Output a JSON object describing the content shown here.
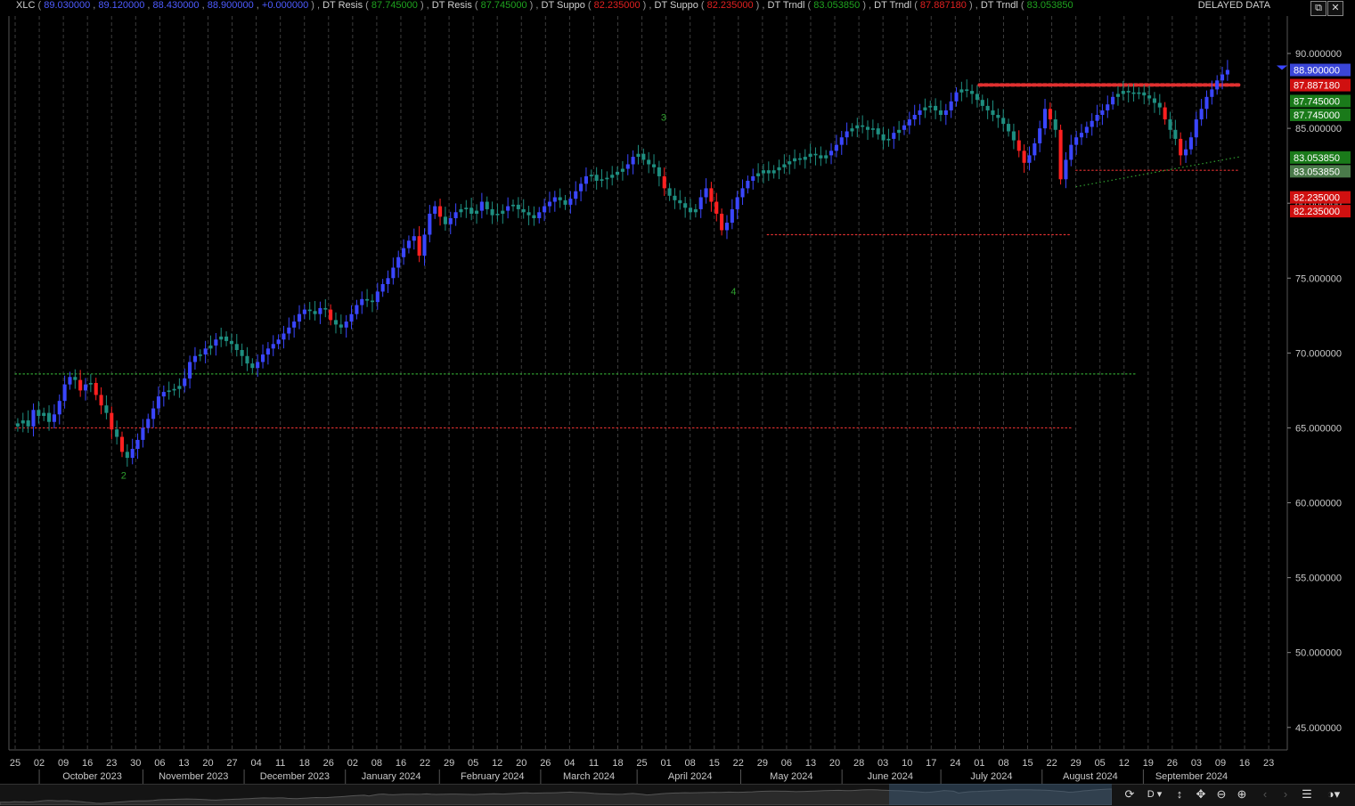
{
  "header": {
    "symbol": "XLC",
    "ohlc": [
      {
        "value": "89.030000",
        "color": "blue"
      },
      {
        "value": "89.120000",
        "color": "blue"
      },
      {
        "value": "88.430000",
        "color": "blue"
      },
      {
        "value": "88.900000",
        "color": "blue"
      },
      {
        "value": "+0.000000",
        "color": "blue"
      }
    ],
    "indicators": [
      {
        "label": "DT Resis",
        "value": "87.745000",
        "color": "green"
      },
      {
        "label": "DT Resis",
        "value": "87.745000",
        "color": "green"
      },
      {
        "label": "DT Suppo",
        "value": "82.235000",
        "color": "red"
      },
      {
        "label": "DT Suppo",
        "value": "82.235000",
        "color": "red"
      },
      {
        "label": "DT Trndl",
        "value": "83.053850",
        "color": "green"
      },
      {
        "label": "DT Trndl",
        "value": "87.887180",
        "color": "red"
      },
      {
        "label": "DT Trndl",
        "value": "83.053850",
        "color": "green"
      }
    ],
    "delayed_label": "DELAYED DATA",
    "restore_icon": "restore-window-icon",
    "close_icon": "close-icon"
  },
  "colors": {
    "up_blue": "#3a46ff",
    "up_teal": "#1e8e80",
    "down_red": "#ff2020",
    "grid": "#3c3c3c",
    "support_red": "#e03030",
    "resis_green": "#30a030",
    "badge_blue": "#3b46d8",
    "badge_red": "#d01010",
    "badge_green": "#1a7a1a",
    "badge_grey_green": "#4a7a4a"
  },
  "chart_data": {
    "type": "candlestick",
    "symbol": "XLC",
    "ylim": [
      43.5,
      92.5
    ],
    "y_ticks": [
      "90.000000",
      "85.000000",
      "80.000000",
      "75.000000",
      "70.000000",
      "65.000000",
      "60.000000",
      "55.000000",
      "50.000000",
      "45.000000"
    ],
    "y_tick_values": [
      90,
      85,
      80,
      75,
      70,
      65,
      60,
      55,
      50,
      45
    ],
    "date_ticks": [
      "25",
      "02",
      "09",
      "16",
      "23",
      "30",
      "06",
      "13",
      "20",
      "27",
      "04",
      "11",
      "18",
      "26",
      "02",
      "08",
      "16",
      "22",
      "29",
      "05",
      "12",
      "20",
      "26",
      "04",
      "11",
      "18",
      "25",
      "01",
      "08",
      "15",
      "22",
      "29",
      "06",
      "13",
      "20",
      "28",
      "03",
      "10",
      "17",
      "24",
      "01",
      "08",
      "15",
      "22",
      "29",
      "05",
      "12",
      "19",
      "26",
      "03",
      "09",
      "16",
      "23"
    ],
    "month_labels": [
      "October 2023",
      "November 2023",
      "December 2023",
      "January 2024",
      "February 2024",
      "March 2024",
      "April 2024",
      "May 2024",
      "June 2024",
      "July 2024",
      "August 2024",
      "September 2024"
    ],
    "month_label_weeks": [
      3.2,
      7.4,
      11.6,
      15.6,
      19.8,
      23.8,
      28.0,
      32.2,
      36.3,
      40.5,
      44.6,
      48.8
    ],
    "month_boundary_weeks": [
      1,
      5.3,
      9.5,
      13.7,
      17.6,
      21.8,
      25.8,
      30.1,
      34.3,
      38.4,
      42.6,
      46.8
    ],
    "price_badges": [
      {
        "value": "88.900000",
        "price": 88.9,
        "color": "badge_blue"
      },
      {
        "value": "87.887180",
        "price": 87.887,
        "color": "badge_red"
      },
      {
        "value": "87.745000",
        "price": 87.745,
        "color": "badge_green"
      },
      {
        "value": "87.745000",
        "price": 87.745,
        "color": "badge_green"
      },
      {
        "value": "83.053850",
        "price": 83.054,
        "color": "badge_green"
      },
      {
        "value": "83.053850",
        "price": 83.054,
        "color": "badge_grey_green"
      },
      {
        "value": "82.235000",
        "price": 82.235,
        "color": "badge_red"
      },
      {
        "value": "82.235000",
        "price": 82.235,
        "color": "badge_red"
      }
    ],
    "wave_labels": [
      {
        "text": "2",
        "week": 4.5,
        "price": 61.6
      },
      {
        "text": "3",
        "week": 26.9,
        "price": 85.5
      },
      {
        "text": "4",
        "week": 29.8,
        "price": 73.9
      }
    ],
    "levels": [
      {
        "name": "old-resistance",
        "price": 68.6,
        "from_week": 0,
        "to_week": 46.5,
        "color": "resis_green"
      },
      {
        "name": "old-support",
        "price": 65.0,
        "from_week": 0,
        "to_week": 43.8,
        "color": "support_red"
      },
      {
        "name": "april-support",
        "price": 77.9,
        "from_week": 31.2,
        "to_week": 43.8,
        "color": "support_red"
      },
      {
        "name": "resistance-top",
        "price": 87.9,
        "from_week": 40,
        "to_week": 50.8,
        "color": "support_red",
        "thick": true
      },
      {
        "name": "support-aug",
        "price": 82.2,
        "from_week": 44,
        "to_week": 50.8,
        "color": "support_red"
      }
    ],
    "trendline": {
      "from_week": 44,
      "from_price": 81.1,
      "to_week": 50.8,
      "to_price": 83.1,
      "color": "resis_green"
    },
    "closes": [
      65.3,
      65.5,
      65.1,
      66.2,
      65.8,
      66.0,
      65.4,
      65.9,
      66.8,
      67.9,
      68.4,
      68.2,
      67.5,
      67.9,
      68.0,
      67.2,
      66.5,
      66.0,
      64.9,
      64.4,
      63.4,
      63.0,
      63.6,
      64.2,
      65.0,
      65.6,
      66.3,
      67.1,
      67.4,
      67.5,
      67.6,
      67.8,
      68.3,
      69.4,
      69.8,
      69.9,
      70.3,
      70.5,
      70.9,
      71.1,
      70.8,
      70.6,
      70.2,
      69.8,
      69.3,
      69.0,
      69.4,
      69.9,
      70.3,
      70.6,
      70.9,
      71.3,
      71.7,
      72.1,
      72.6,
      72.9,
      72.8,
      72.6,
      73.0,
      72.9,
      72.2,
      71.9,
      71.7,
      72.1,
      72.6,
      73.2,
      73.6,
      73.5,
      73.4,
      74.1,
      74.6,
      75.0,
      75.7,
      76.4,
      77.0,
      77.5,
      77.8,
      76.5,
      77.9,
      79.3,
      79.8,
      79.1,
      78.6,
      79.0,
      79.4,
      79.6,
      79.7,
      79.3,
      79.5,
      80.1,
      79.6,
      79.2,
      79.3,
      79.5,
      79.8,
      79.9,
      79.6,
      79.4,
      79.2,
      79.0,
      79.4,
      79.8,
      80.1,
      80.4,
      80.2,
      79.9,
      80.3,
      80.8,
      81.3,
      81.8,
      81.9,
      81.5,
      81.6,
      81.7,
      81.9,
      82.1,
      82.3,
      82.6,
      83.1,
      83.3,
      82.9,
      82.6,
      82.4,
      81.8,
      81.0,
      80.5,
      80.2,
      80.0,
      79.7,
      79.4,
      79.6,
      80.4,
      81.0,
      80.1,
      79.3,
      78.2,
      78.7,
      79.6,
      80.4,
      81.0,
      81.5,
      81.8,
      82.0,
      82.2,
      82.0,
      82.2,
      82.4,
      82.6,
      82.8,
      83.0,
      82.9,
      83.1,
      83.3,
      83.2,
      83.0,
      83.2,
      83.5,
      83.9,
      84.4,
      84.8,
      85.0,
      85.2,
      85.1,
      84.9,
      85.0,
      84.6,
      84.2,
      84.3,
      84.7,
      84.9,
      85.2,
      85.6,
      85.9,
      86.2,
      86.4,
      86.5,
      86.2,
      85.9,
      86.2,
      86.8,
      87.4,
      87.6,
      87.5,
      87.3,
      86.9,
      86.5,
      86.2,
      85.9,
      85.7,
      85.3,
      84.8,
      84.2,
      83.5,
      82.7,
      83.2,
      84.0,
      85.0,
      86.3,
      85.6,
      84.9,
      81.6,
      82.9,
      83.9,
      84.4,
      84.7,
      85.1,
      85.5,
      85.9,
      86.2,
      86.6,
      87.1,
      87.3,
      87.5,
      87.4,
      87.3,
      87.4,
      87.2,
      87.0,
      86.7,
      86.4,
      85.6,
      84.9,
      84.3,
      83.2,
      83.6,
      84.4,
      85.6,
      86.3,
      87.1,
      87.6,
      88.2,
      88.6,
      88.9
    ]
  }
}
